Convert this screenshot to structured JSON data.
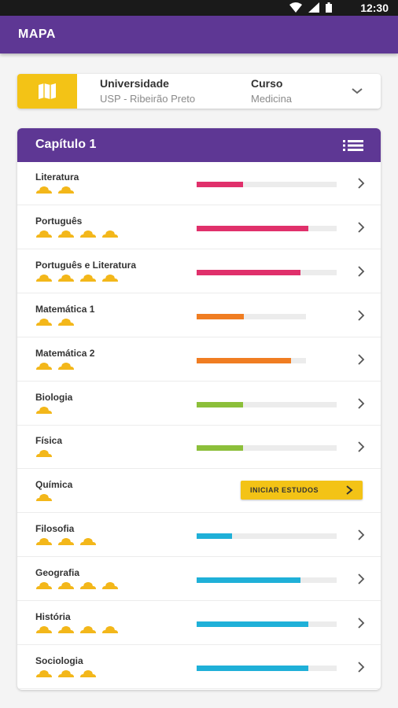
{
  "status_bar": {
    "time": "12:30"
  },
  "app_bar": {
    "title": "MAPA"
  },
  "selection": {
    "university_label": "Universidade",
    "university_value": "USP - Ribeirão Preto",
    "course_label": "Curso",
    "course_value": "Medicina"
  },
  "chapter": {
    "title": "Capítulo 1",
    "subjects": [
      {
        "name": "Literatura",
        "stars": 2,
        "progress": 0.33,
        "color": "#e0306b"
      },
      {
        "name": "Português",
        "stars": 4,
        "progress": 0.8,
        "color": "#e0306b"
      },
      {
        "name": "Português e Literatura",
        "stars": 4,
        "progress": 0.74,
        "color": "#e0306b"
      },
      {
        "name": "Matemática 1",
        "stars": 2,
        "progress": 0.43,
        "color": "#f07d22"
      },
      {
        "name": "Matemática 2",
        "stars": 2,
        "progress": 0.86,
        "color": "#f07d22"
      },
      {
        "name": "Biologia",
        "stars": 1,
        "progress": 0.33,
        "color": "#8cbf3a"
      },
      {
        "name": "Física",
        "stars": 1,
        "progress": 0.33,
        "color": "#8cbf3a"
      },
      {
        "name": "Química",
        "stars": 1,
        "action_label": "INICIAR ESTUDOS"
      },
      {
        "name": "Filosofia",
        "stars": 3,
        "progress": 0.25,
        "color": "#1fb0d8"
      },
      {
        "name": "Geografia",
        "stars": 4,
        "progress": 0.74,
        "color": "#1fb0d8"
      },
      {
        "name": "História",
        "stars": 4,
        "progress": 0.8,
        "color": "#1fb0d8"
      },
      {
        "name": "Sociologia",
        "stars": 3,
        "progress": 0.8,
        "color": "#1fb0d8"
      }
    ]
  },
  "colors": {
    "primary": "#5e3794",
    "accent": "#f3c316",
    "star": "#f3b71a"
  },
  "icons": {
    "map": "map-icon",
    "dropdown": "chevron-down-icon",
    "list": "list-icon",
    "arrow": "chevron-right-icon",
    "star": "star-icon"
  }
}
